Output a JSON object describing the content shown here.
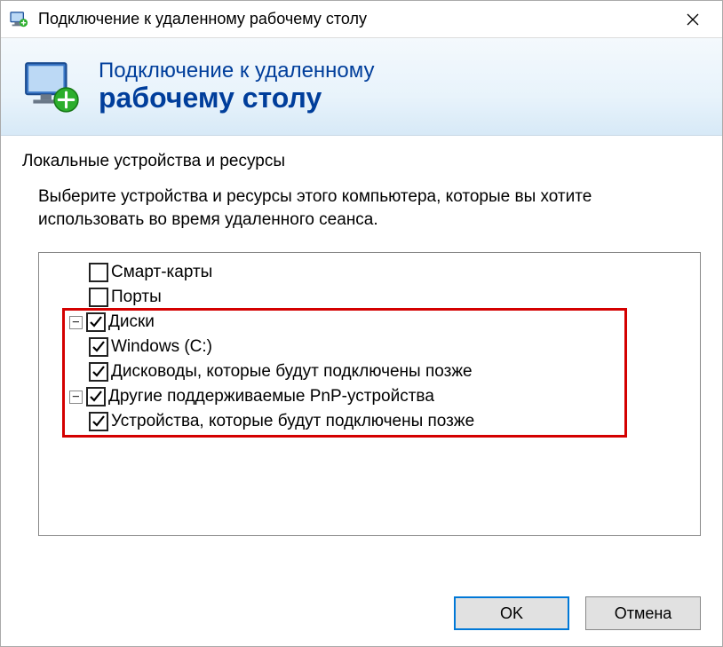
{
  "window": {
    "title": "Подключение к удаленному рабочему столу"
  },
  "banner": {
    "line1": "Подключение к удаленному",
    "line2": "рабочему столу"
  },
  "section": {
    "title": "Локальные устройства и ресурсы",
    "description": "Выберите устройства и ресурсы этого компьютера, которые вы хотите использовать во время удаленного сеанса."
  },
  "tree": {
    "items": [
      {
        "label": "Смарт-карты",
        "checked": false,
        "level": 1,
        "expandable": false
      },
      {
        "label": "Порты",
        "checked": false,
        "level": 1,
        "expandable": false
      },
      {
        "label": "Диски",
        "checked": true,
        "level": 0,
        "expandable": true,
        "expanded": true
      },
      {
        "label": "Windows (C:)",
        "checked": true,
        "level": 1,
        "expandable": false
      },
      {
        "label": "Дисководы, которые будут подключены позже",
        "checked": true,
        "level": 1,
        "expandable": false
      },
      {
        "label": "Другие поддерживаемые PnP-устройства",
        "checked": true,
        "level": 0,
        "expandable": true,
        "expanded": true
      },
      {
        "label": "Устройства, которые будут подключены позже",
        "checked": true,
        "level": 1,
        "expandable": false
      }
    ]
  },
  "buttons": {
    "ok": "OK",
    "cancel": "Отмена"
  }
}
